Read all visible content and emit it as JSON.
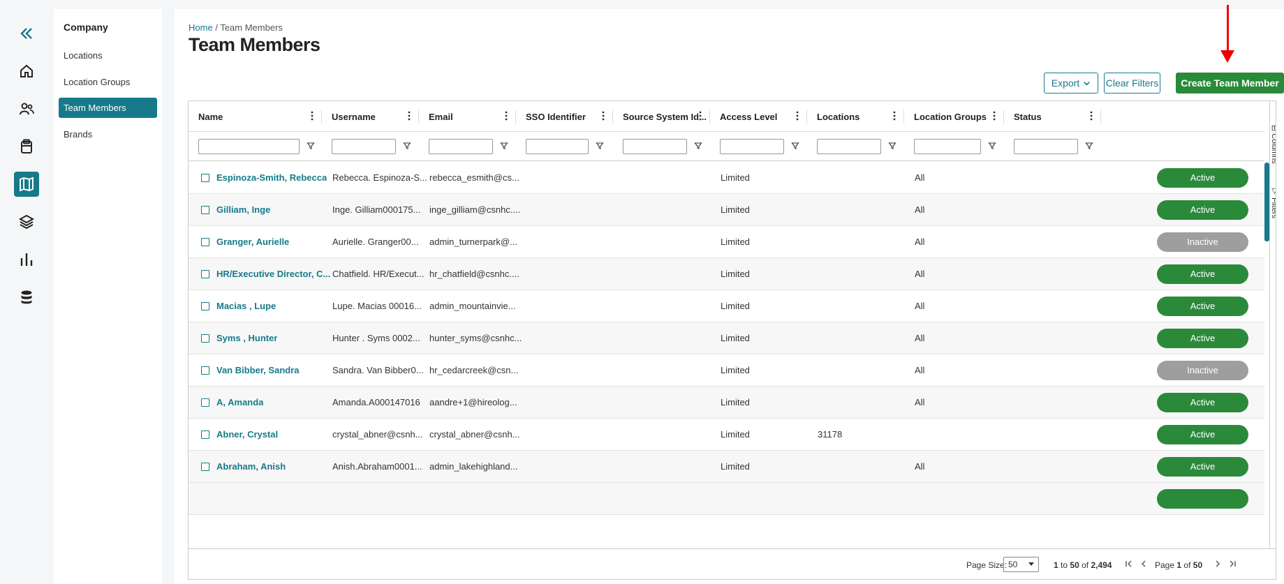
{
  "rail": {
    "items": [
      {
        "icon": "collapse-icon"
      },
      {
        "icon": "home-icon"
      },
      {
        "icon": "people-icon"
      },
      {
        "icon": "clipboard-icon"
      },
      {
        "icon": "map-icon",
        "active": true
      },
      {
        "icon": "layers-icon"
      },
      {
        "icon": "bar-chart-icon"
      },
      {
        "icon": "database-icon"
      }
    ]
  },
  "subnav": {
    "title": "Company",
    "items": [
      {
        "label": "Locations"
      },
      {
        "label": "Location Groups"
      },
      {
        "label": "Team Members",
        "active": true
      },
      {
        "label": "Brands"
      }
    ]
  },
  "breadcrumb": {
    "home": "Home",
    "sep": "/",
    "current": "Team Members"
  },
  "page_title": "Team Members",
  "toolbar": {
    "export_label": "Export",
    "clear_filters_label": "Clear Filters",
    "create_label": "Create Team Member"
  },
  "grid": {
    "columns": [
      "Name",
      "Username",
      "Email",
      "SSO Identifier",
      "Source System Id...",
      "Access Level",
      "Locations",
      "Location Groups",
      "Status"
    ],
    "rows": [
      {
        "name": "Espinoza-Smith, Rebecca",
        "username": "Rebecca. Espinoza-S...",
        "email": "rebecca_esmith@cs...",
        "sso": "",
        "source": "",
        "access": "Limited",
        "locations": "",
        "groups": "All",
        "status": "Active"
      },
      {
        "name": "Gilliam, Inge",
        "username": "Inge. Gilliam000175...",
        "email": "inge_gilliam@csnhc....",
        "sso": "",
        "source": "",
        "access": "Limited",
        "locations": "",
        "groups": "All",
        "status": "Active"
      },
      {
        "name": "Granger, Aurielle",
        "username": "Aurielle. Granger00...",
        "email": "admin_turnerpark@...",
        "sso": "",
        "source": "",
        "access": "Limited",
        "locations": "",
        "groups": "All",
        "status": "Inactive"
      },
      {
        "name": "HR/Executive Director, C...",
        "username": "Chatfield. HR/Execut...",
        "email": "hr_chatfield@csnhc....",
        "sso": "",
        "source": "",
        "access": "Limited",
        "locations": "",
        "groups": "All",
        "status": "Active"
      },
      {
        "name": "Macias , Lupe",
        "username": "Lupe. Macias 00016...",
        "email": "admin_mountainvie...",
        "sso": "",
        "source": "",
        "access": "Limited",
        "locations": "",
        "groups": "All",
        "status": "Active"
      },
      {
        "name": "Syms , Hunter",
        "username": "Hunter . Syms 0002...",
        "email": "hunter_syms@csnhc...",
        "sso": "",
        "source": "",
        "access": "Limited",
        "locations": "",
        "groups": "All",
        "status": "Active"
      },
      {
        "name": "Van Bibber, Sandra",
        "username": "Sandra. Van Bibber0...",
        "email": "hr_cedarcreek@csn...",
        "sso": "",
        "source": "",
        "access": "Limited",
        "locations": "",
        "groups": "All",
        "status": "Inactive"
      },
      {
        "name": "A, Amanda",
        "username": "Amanda.A000147016",
        "email": "aandre+1@hireolog...",
        "sso": "",
        "source": "",
        "access": "Limited",
        "locations": "",
        "groups": "All",
        "status": "Active"
      },
      {
        "name": "Abner, Crystal",
        "username": "crystal_abner@csnh...",
        "email": "crystal_abner@csnh...",
        "sso": "",
        "source": "",
        "access": "Limited",
        "locations": "31178",
        "groups": "",
        "status": "Active"
      },
      {
        "name": "Abraham, Anish",
        "username": "Anish.Abraham0001...",
        "email": "admin_lakehighland...",
        "sso": "",
        "source": "",
        "access": "Limited",
        "locations": "",
        "groups": "All",
        "status": "Active"
      }
    ]
  },
  "side_tools": {
    "columns_label": "Columns",
    "filters_label": "Filters"
  },
  "pagination": {
    "page_size_label": "Page Size:",
    "page_size": "50",
    "range_from": "1",
    "range_to_word": "to",
    "range_to": "50",
    "of_word": "of",
    "total": "2,494",
    "page_word": "Page",
    "current_page": "1",
    "total_pages": "50"
  },
  "colors": {
    "accent": "#167a8b",
    "active": "#2a8a3a",
    "inactive": "#9e9e9e",
    "annotation_arrow": "#ee0000"
  }
}
